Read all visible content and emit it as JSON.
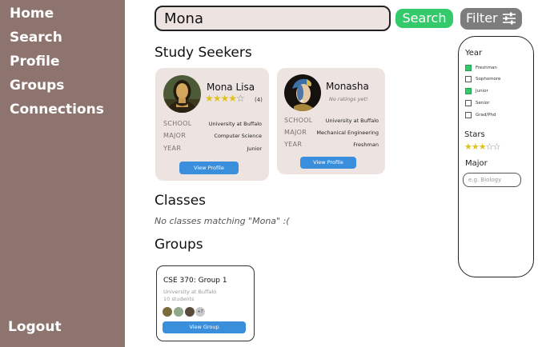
{
  "sidebar": {
    "items": [
      "Home",
      "Search",
      "Profile",
      "Groups",
      "Connections"
    ],
    "logout": "Logout"
  },
  "search": {
    "value": "Mona",
    "button": "Search",
    "filter_button": "Filter"
  },
  "sections": {
    "study_seekers": "Study Seekers",
    "classes": "Classes",
    "classes_empty": "No classes matching \"Mona\" :(",
    "groups": "Groups"
  },
  "people": [
    {
      "name": "Mona Lisa",
      "rating": 4,
      "max_rating": 5,
      "rating_count": "(4)",
      "school_label": "SCHOOL",
      "school": "University at Buffalo",
      "major_label": "MAJOR",
      "major": "Computer Science",
      "year_label": "YEAR",
      "year": "Junior",
      "button": "View Profile"
    },
    {
      "name": "Monasha",
      "no_ratings": "No ratings yet!",
      "school_label": "SCHOOL",
      "school": "University at Buffalo",
      "major_label": "MAJOR",
      "major": "Mechanical Engineering",
      "year_label": "YEAR",
      "year": "Freshman",
      "button": "View Profile"
    }
  ],
  "group": {
    "title": "CSE 370: Group 1",
    "school": "University at Buffalo",
    "size": "10 students",
    "more_members": "+7",
    "button": "View Group"
  },
  "filters": {
    "year_heading": "Year",
    "years": [
      {
        "label": "Freshman",
        "checked": true
      },
      {
        "label": "Sophomore",
        "checked": false
      },
      {
        "label": "Junior",
        "checked": true
      },
      {
        "label": "Senior",
        "checked": false
      },
      {
        "label": "Grad/Phd",
        "checked": false
      }
    ],
    "stars_heading": "Stars",
    "stars_value": 3,
    "stars_max": 5,
    "major_heading": "Major",
    "major_placeholder": "e.g. Biology"
  },
  "colors": {
    "sidebar": "#8e746f",
    "accent_green": "#34c96b",
    "accent_blue": "#3a8fdd",
    "card_bg": "#ede4e2"
  }
}
